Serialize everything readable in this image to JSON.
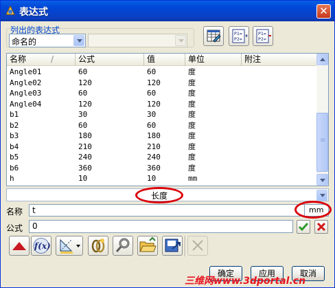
{
  "window": {
    "title": "表达式",
    "close_label": "✕"
  },
  "filter": {
    "group_label": "列出的表达式",
    "selected": "命名的",
    "secondary_selected": ""
  },
  "toolbar_icons": [
    "spreadsheet-edit-icon",
    "list-parameters-icon",
    "compare-parameters-icon"
  ],
  "table": {
    "columns": [
      "名称",
      "公式",
      "值",
      "单位",
      "附注"
    ],
    "sort_indicator": "/",
    "rows": [
      {
        "name": "Angle01",
        "formula": "60",
        "value": "60",
        "unit": "度",
        "note": ""
      },
      {
        "name": "Angle02",
        "formula": "120",
        "value": "120",
        "unit": "度",
        "note": ""
      },
      {
        "name": "Angle03",
        "formula": "60",
        "value": "60",
        "unit": "度",
        "note": ""
      },
      {
        "name": "Angle04",
        "formula": "120",
        "value": "120",
        "unit": "度",
        "note": ""
      },
      {
        "name": "b1",
        "formula": "30",
        "value": "30",
        "unit": "度",
        "note": ""
      },
      {
        "name": "b2",
        "formula": "60",
        "value": "60",
        "unit": "度",
        "note": ""
      },
      {
        "name": "b3",
        "formula": "180",
        "value": "180",
        "unit": "度",
        "note": ""
      },
      {
        "name": "b4",
        "formula": "210",
        "value": "210",
        "unit": "度",
        "note": ""
      },
      {
        "name": "b5",
        "formula": "240",
        "value": "240",
        "unit": "度",
        "note": ""
      },
      {
        "name": "b6",
        "formula": "360",
        "value": "360",
        "unit": "度",
        "note": ""
      },
      {
        "name": "h",
        "formula": "10",
        "value": "10",
        "unit": "mm",
        "note": ""
      }
    ]
  },
  "unit_type": {
    "selected": "长度"
  },
  "name_field": {
    "label": "名称",
    "value": "t",
    "unit": "mm"
  },
  "formula_field": {
    "label": "公式",
    "value": "0"
  },
  "bottom_tools": [
    "function-icon",
    "insert-function-icon",
    "measure-icon",
    "link-part-icon",
    "link-expression-icon",
    "open-file-icon",
    "save-expression-icon",
    "delete-icon"
  ],
  "dialog_buttons": {
    "ok": "确定",
    "apply": "应用",
    "cancel": "取消"
  },
  "watermark": "三维网www.3dportal.cn",
  "colors": {
    "title_bar": "#0a47d6",
    "accent_red": "#d9000a",
    "confirm_green": "#2e9a2e"
  }
}
